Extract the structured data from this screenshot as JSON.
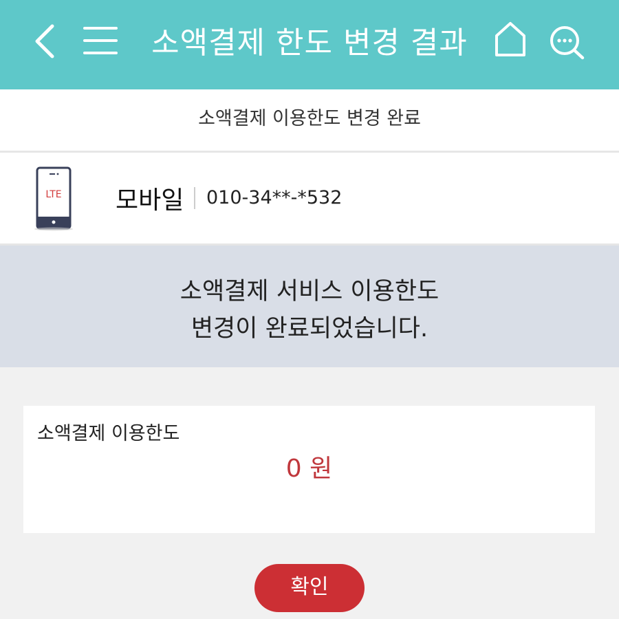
{
  "header": {
    "title": "소액결제 한도 변경 결과",
    "icons": [
      "chevron-left-icon",
      "menu-icon",
      "home-icon",
      "chat-search-icon"
    ],
    "background_color": "#5ec8c9"
  },
  "subheader": {
    "title": "소액결제 이용한도 변경 완료"
  },
  "device": {
    "icon_label": "LTE",
    "type": "모바일",
    "number": "010-34**-*532"
  },
  "notice": {
    "line1": "소액결제 서비스 이용한도",
    "line2": "변경이 완료되었습니다."
  },
  "limit_card": {
    "label": "소액결제 이용한도",
    "amount": "0 원"
  },
  "confirm_button": {
    "label": "확인",
    "color": "#cc2f34"
  }
}
